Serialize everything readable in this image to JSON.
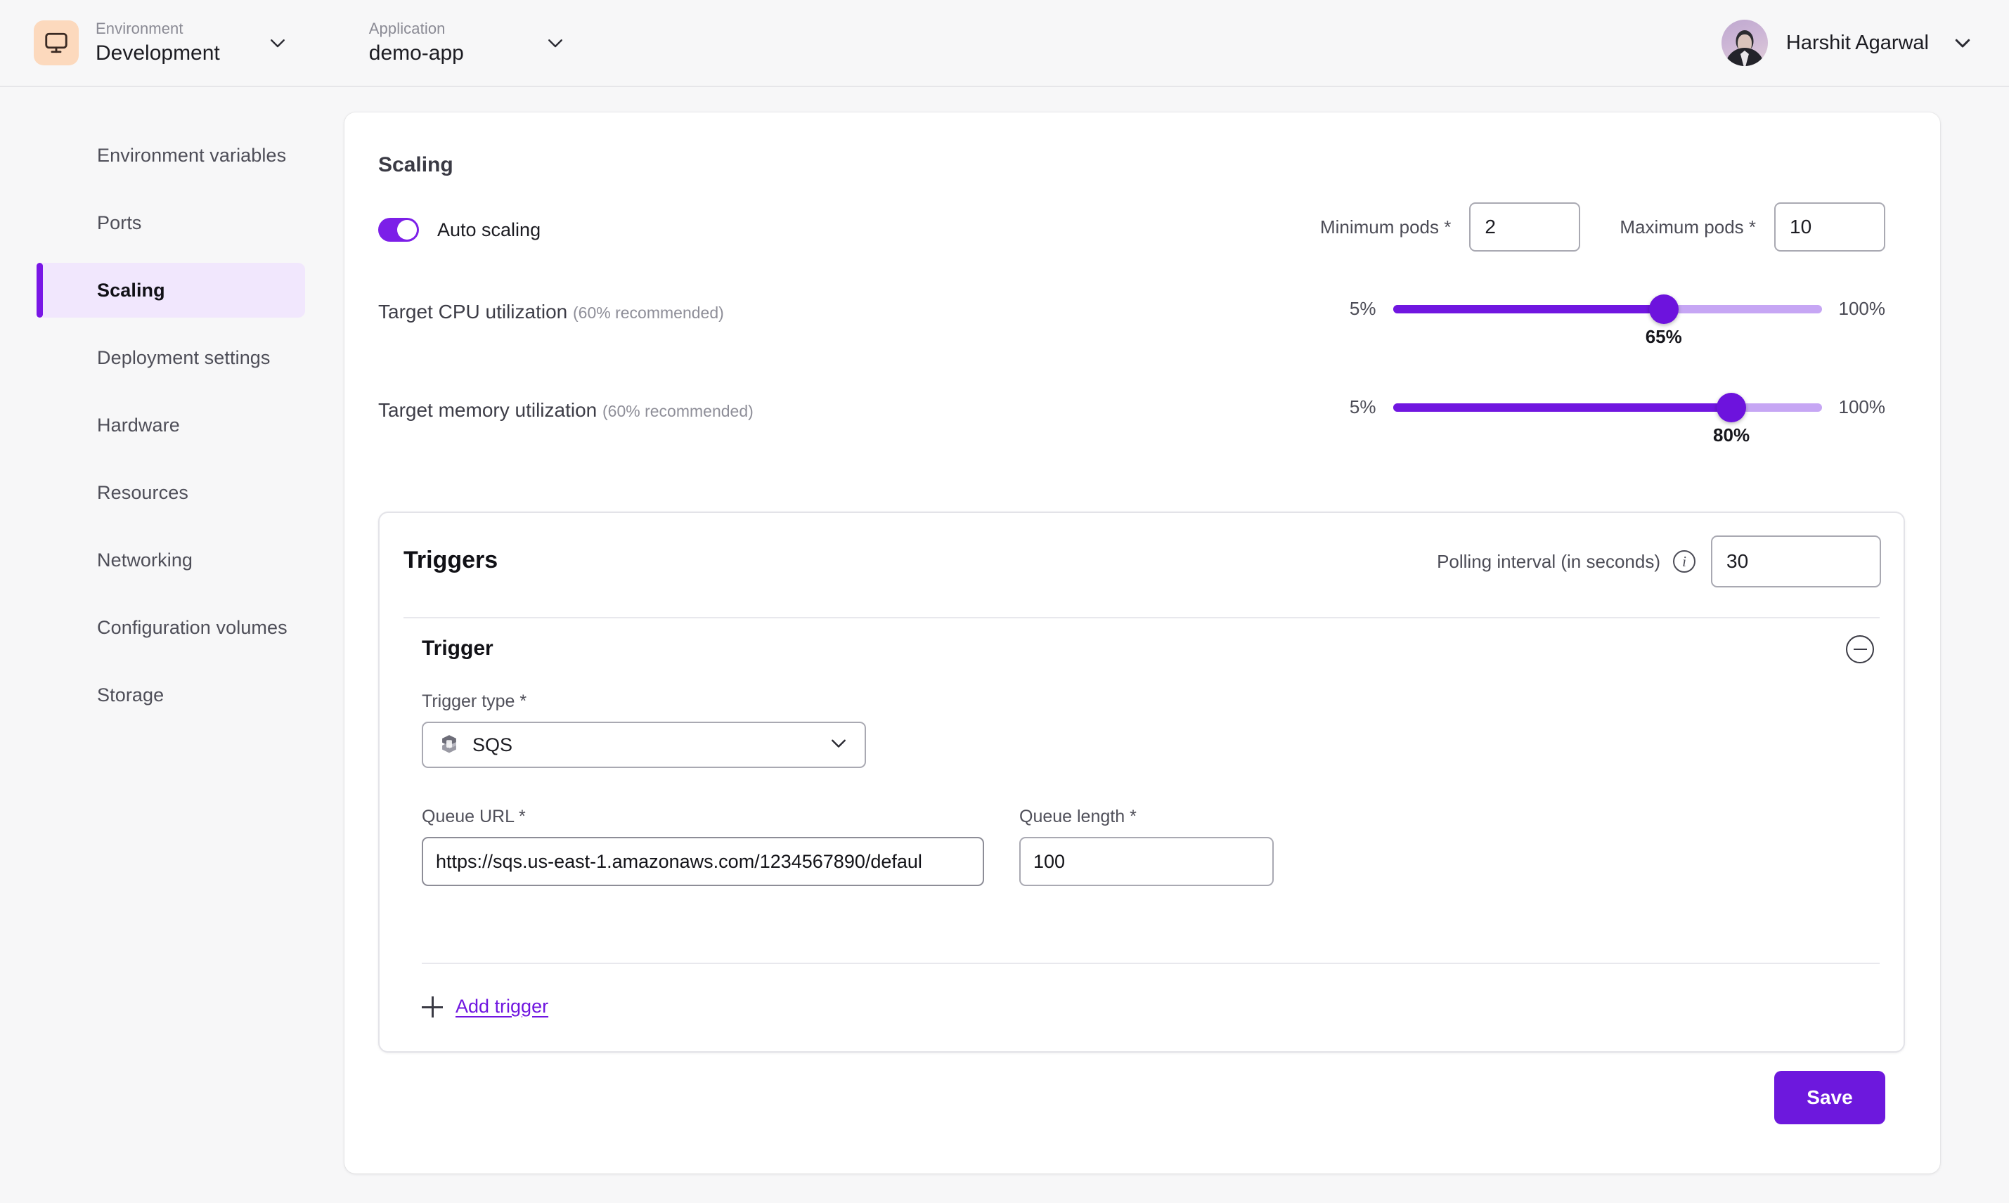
{
  "topbar": {
    "environment": {
      "label": "Environment",
      "value": "Development",
      "icon": "monitor-icon"
    },
    "application": {
      "label": "Application",
      "value": "demo-app"
    },
    "user": {
      "name": "Harshit Agarwal"
    }
  },
  "sidebar": {
    "items": [
      {
        "label": "Environment variables",
        "active": false
      },
      {
        "label": "Ports",
        "active": false
      },
      {
        "label": "Scaling",
        "active": true
      },
      {
        "label": "Deployment settings",
        "active": false
      },
      {
        "label": "Hardware",
        "active": false
      },
      {
        "label": "Resources",
        "active": false
      },
      {
        "label": "Networking",
        "active": false
      },
      {
        "label": "Configuration volumes",
        "active": false
      },
      {
        "label": "Storage",
        "active": false
      }
    ]
  },
  "main": {
    "title": "Scaling",
    "auto_scaling": {
      "label": "Auto scaling",
      "enabled": true
    },
    "minimum_pods": {
      "label": "Minimum pods *",
      "value": "2"
    },
    "maximum_pods": {
      "label": "Maximum pods *",
      "value": "10"
    },
    "cpu": {
      "label": "Target CPU utilization",
      "hint": "(60% recommended)",
      "min_label": "5%",
      "max_label": "100%",
      "value_label": "65%",
      "min": 5,
      "max": 100,
      "value": 65
    },
    "memory": {
      "label": "Target memory utilization",
      "hint": "(60% recommended)",
      "min_label": "5%",
      "max_label": "100%",
      "value_label": "80%",
      "min": 5,
      "max": 100,
      "value": 80
    },
    "triggers": {
      "title": "Triggers",
      "polling_label": "Polling interval (in seconds)",
      "polling_value": "30",
      "trigger_title": "Trigger",
      "trigger_type_label": "Trigger type *",
      "trigger_type_value": "SQS",
      "queue_url_label": "Queue URL *",
      "queue_url_value": "https://sqs.us-east-1.amazonaws.com/1234567890/defaul",
      "queue_length_label": "Queue length *",
      "queue_length_value": "100",
      "add_trigger_label": "Add trigger"
    },
    "save_label": "Save"
  },
  "colors": {
    "accent": "#7016e0",
    "accent_dark": "#6d13dd",
    "track_light": "#c6a6f4",
    "active_nav_bg": "#f1e7fd",
    "env_icon_bg": "#fcd9bd"
  }
}
